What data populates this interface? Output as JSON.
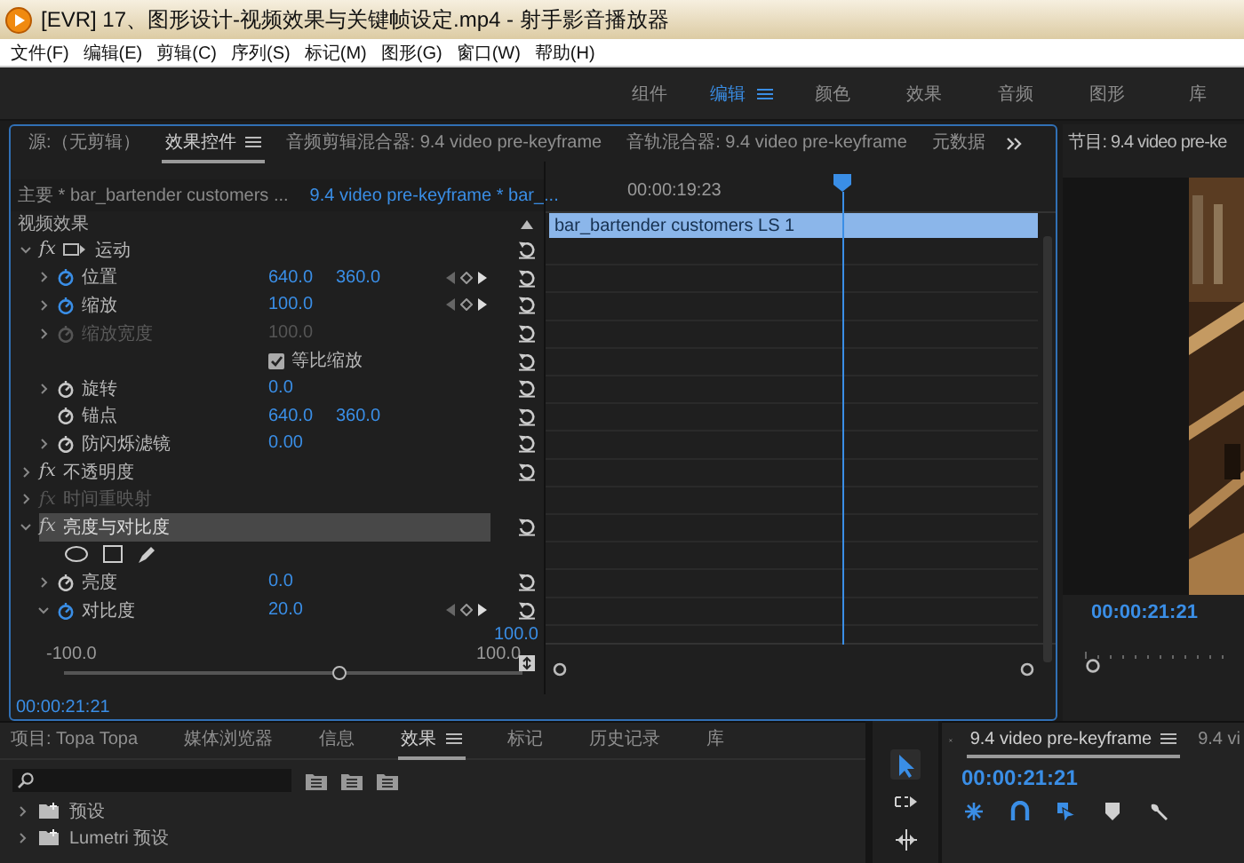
{
  "window": {
    "title": "[EVR] 17、图形设计-视频效果与关键帧设定.mp4 - 射手影音播放器"
  },
  "menu": [
    "文件(F)",
    "编辑(E)",
    "剪辑(C)",
    "序列(S)",
    "标记(M)",
    "图形(G)",
    "窗口(W)",
    "帮助(H)"
  ],
  "workspaces": [
    {
      "label": "组件",
      "selected": false
    },
    {
      "label": "编辑",
      "selected": true
    },
    {
      "label": "颜色",
      "selected": false
    },
    {
      "label": "效果",
      "selected": false
    },
    {
      "label": "音频",
      "selected": false
    },
    {
      "label": "图形",
      "selected": false
    },
    {
      "label": "库",
      "selected": false
    }
  ],
  "effect_panel": {
    "tabs": [
      {
        "label": "源:（无剪辑）",
        "selected": false
      },
      {
        "label": "效果控件",
        "selected": true
      },
      {
        "label": "音频剪辑混合器: 9.4 video pre-keyframe",
        "selected": false
      },
      {
        "label": "音轨混合器: 9.4 video pre-keyframe",
        "selected": false
      },
      {
        "label": "元数据",
        "selected": false
      }
    ],
    "source_clip": "主要 * bar_bartender customers ...",
    "sequence_clip": "9.4 video pre-keyframe * bar_...",
    "section": "视频效果",
    "effects": [
      {
        "kind": "motion",
        "badge": "fx",
        "name": "运动",
        "expanded": true,
        "disabled": false,
        "highlighted": false,
        "reset": true,
        "children": [
          {
            "kind": "property",
            "name": "位置",
            "expanded": false,
            "animated": true,
            "values": [
              "640.0",
              "360.0"
            ],
            "keyframes": true,
            "disabled": false,
            "reset": true
          },
          {
            "kind": "property",
            "name": "缩放",
            "expanded": false,
            "animated": true,
            "values": [
              "100.0"
            ],
            "keyframes": true,
            "disabled": false,
            "reset": true
          },
          {
            "kind": "property",
            "name": "缩放宽度",
            "expanded": false,
            "animated": false,
            "values": [
              "100.0"
            ],
            "keyframes": false,
            "disabled": true,
            "reset": true
          },
          {
            "kind": "checkbox",
            "label": "等比缩放",
            "checked": true,
            "reset": true
          },
          {
            "kind": "property",
            "name": "旋转",
            "expanded": false,
            "animated": false,
            "values": [
              "0.0"
            ],
            "keyframes": false,
            "disabled": false,
            "reset": true
          },
          {
            "kind": "property",
            "name": "锚点",
            "animated": false,
            "values": [
              "640.0",
              "360.0"
            ],
            "keyframes": false,
            "disabled": false,
            "reset": true
          },
          {
            "kind": "property",
            "name": "防闪烁滤镜",
            "expanded": false,
            "animated": false,
            "values": [
              "0.00"
            ],
            "keyframes": false,
            "disabled": false,
            "reset": true
          }
        ]
      },
      {
        "kind": "effect",
        "badge": "fx",
        "name": "不透明度",
        "expanded": false,
        "disabled": false,
        "highlighted": false,
        "reset": true
      },
      {
        "kind": "effect",
        "badge": "fx",
        "name": "时间重映射",
        "expanded": false,
        "disabled": true,
        "highlighted": false,
        "reset": false
      },
      {
        "kind": "effect",
        "badge": "fx",
        "name": "亮度与对比度",
        "expanded": true,
        "disabled": false,
        "highlighted": true,
        "reset": true,
        "children": [
          {
            "kind": "mask-tools"
          },
          {
            "kind": "property",
            "name": "亮度",
            "expanded": false,
            "animated": false,
            "values": [
              "0.0"
            ],
            "keyframes": false,
            "disabled": false,
            "reset": true
          },
          {
            "kind": "property",
            "name": "对比度",
            "expanded": true,
            "animated": true,
            "values": [
              "20.0"
            ],
            "keyframes": true,
            "disabled": false,
            "reset": true,
            "children": [
              {
                "kind": "slider",
                "max_value": "100.0",
                "min_label": "-100.0",
                "max_label": "100.0",
                "level": 0.6
              }
            ]
          }
        ]
      }
    ],
    "timeline": {
      "time": "00:00:19:23",
      "clip": "bar_bartender customers LS 1"
    },
    "timecode": "00:00:21:21"
  },
  "program_monitor": {
    "title": "节目: 9.4 video pre-ke",
    "timecode": "00:00:21:21"
  },
  "project_panel": {
    "tabs": [
      {
        "label": "项目: Topa Topa",
        "selected": false
      },
      {
        "label": "媒体浏览器",
        "selected": false
      },
      {
        "label": "信息",
        "selected": false
      },
      {
        "label": "效果",
        "selected": true
      },
      {
        "label": "标记",
        "selected": false
      },
      {
        "label": "历史记录",
        "selected": false
      },
      {
        "label": "库",
        "selected": false
      }
    ],
    "tree": [
      {
        "label": "预设",
        "expanded": false
      },
      {
        "label": "Lumetri 预设",
        "expanded": false
      }
    ]
  },
  "tools": [
    {
      "kind": "select",
      "selected": true
    },
    {
      "kind": "track-select",
      "selected": false
    },
    {
      "kind": "ripple",
      "selected": false
    }
  ],
  "sequence_panel": {
    "tabs": [
      {
        "label": "9.4 video pre-keyframe",
        "selected": true
      },
      {
        "label": "9.4 vi",
        "selected": false
      }
    ],
    "timecode": "00:00:21:21",
    "toggles": [
      {
        "kind": "nest",
        "on": true
      },
      {
        "kind": "snap",
        "on": true
      },
      {
        "kind": "linked",
        "on": true
      },
      {
        "kind": "marker",
        "on": false
      },
      {
        "kind": "settings",
        "on": false
      }
    ]
  }
}
